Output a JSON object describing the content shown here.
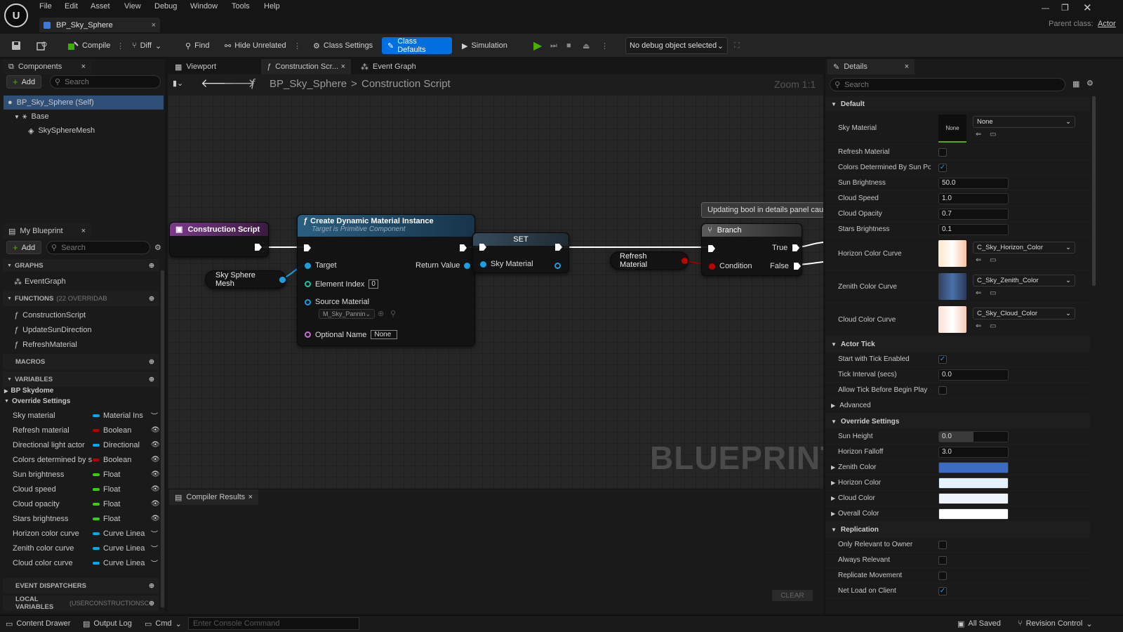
{
  "menu": [
    "File",
    "Edit",
    "Asset",
    "View",
    "Debug",
    "Window",
    "Tools",
    "Help"
  ],
  "document_tab": "BP_Sky_Sphere",
  "parent_class_label": "Parent class:",
  "parent_class_value": "Actor",
  "toolbar": {
    "compile": "Compile",
    "diff": "Diff",
    "find": "Find",
    "hide_unrelated": "Hide Unrelated",
    "class_settings": "Class Settings",
    "class_defaults": "Class Defaults",
    "simulation": "Simulation",
    "debug_object": "No debug object selected"
  },
  "components": {
    "title": "Components",
    "add": "Add",
    "search_placeholder": "Search",
    "self": "BP_Sky_Sphere (Self)",
    "base": "Base",
    "mesh": "SkySphereMesh"
  },
  "my_blueprint": {
    "title": "My Blueprint",
    "add": "Add",
    "search_placeholder": "Search",
    "graphs_label": "GRAPHS",
    "event_graph": "EventGraph",
    "functions_label": "FUNCTIONS",
    "functions_note": "(22 OVERRIDAB",
    "functions": [
      "ConstructionScript",
      "UpdateSunDirection",
      "RefreshMaterial"
    ],
    "macros_label": "MACROS",
    "variables_label": "VARIABLES",
    "categories": [
      "BP Skydome",
      "Override Settings"
    ],
    "variables": [
      {
        "name": "Sky material",
        "type": "Material Ins",
        "color": "#00a8f0"
      },
      {
        "name": "Refresh material",
        "type": "Boolean",
        "color": "#b00000"
      },
      {
        "name": "Directional light actor",
        "type": "Directional",
        "color": "#00a8f0"
      },
      {
        "name": "Colors determined by s",
        "type": "Boolean",
        "color": "#b00000"
      },
      {
        "name": "Sun brightness",
        "type": "Float",
        "color": "#38d000"
      },
      {
        "name": "Cloud speed",
        "type": "Float",
        "color": "#38d000"
      },
      {
        "name": "Cloud opacity",
        "type": "Float",
        "color": "#38d000"
      },
      {
        "name": "Stars brightness",
        "type": "Float",
        "color": "#38d000"
      },
      {
        "name": "Horizon color curve",
        "type": "Curve Linea",
        "color": "#00a8f0"
      },
      {
        "name": "Zenith color curve",
        "type": "Curve Linea",
        "color": "#00a8f0"
      },
      {
        "name": "Cloud color curve",
        "type": "Curve Linea",
        "color": "#00a8f0"
      }
    ],
    "event_dispatchers_label": "EVENT DISPATCHERS",
    "local_variables_label": "LOCAL VARIABLES",
    "local_variables_note": "(USERCONSTRUCTIONSC"
  },
  "editor_tabs": [
    "Viewport",
    "Construction Scr...",
    "Event Graph"
  ],
  "breadcrumb": {
    "blueprint": "BP_Sky_Sphere",
    "graph": "Construction Script"
  },
  "zoom": "Zoom 1:1",
  "watermark": "BLUEPRINT",
  "nodes": {
    "construction_script": "Construction Script",
    "sky_sphere_mesh": "Sky Sphere Mesh",
    "create_dmi_title": "Create Dynamic Material Instance",
    "create_dmi_subtitle": "Target is Primitive Component",
    "target": "Target",
    "return_value": "Return Value",
    "element_index": "Element Index",
    "element_index_value": "0",
    "source_material": "Source Material",
    "source_material_value": "M_Sky_Panning",
    "optional_name": "Optional Name",
    "optional_name_value": "None",
    "set": "SET",
    "sky_material": "Sky Material",
    "refresh_material": "Refresh Material",
    "comment": "Updating bool in details panel cause",
    "branch": "Branch",
    "condition": "Condition",
    "true_pin": "True",
    "false_pin": "False"
  },
  "compiler": {
    "tab": "Compiler Results",
    "clear": "CLEAR"
  },
  "details": {
    "title": "Details",
    "search_placeholder": "Search",
    "default_section": "Default",
    "sky_material_label": "Sky Material",
    "sky_material_thumb": "None",
    "sky_material_value": "None",
    "refresh_material_label": "Refresh Material",
    "colors_determined_label": "Colors Determined By Sun Pos...",
    "sun_brightness_label": "Sun Brightness",
    "sun_brightness": "50.0",
    "cloud_speed_label": "Cloud Speed",
    "cloud_speed": "1.0",
    "cloud_opacity_label": "Cloud Opacity",
    "cloud_opacity": "0.7",
    "stars_brightness_label": "Stars Brightness",
    "stars_brightness": "0.1",
    "horizon_curve_label": "Horizon Color Curve",
    "horizon_curve": "C_Sky_Horizon_Color",
    "zenith_curve_label": "Zenith Color Curve",
    "zenith_curve": "C_Sky_Zenith_Color",
    "cloud_curve_label": "Cloud Color Curve",
    "cloud_curve": "C_Sky_Cloud_Color",
    "actor_tick_section": "Actor Tick",
    "start_tick_label": "Start with Tick Enabled",
    "tick_interval_label": "Tick Interval (secs)",
    "tick_interval": "0.0",
    "allow_tick_label": "Allow Tick Before Begin Play",
    "advanced_label": "Advanced",
    "override_section": "Override Settings",
    "sun_height_label": "Sun Height",
    "sun_height": "0.0",
    "sun_height_fraction": 0.5,
    "horizon_falloff_label": "Horizon Falloff",
    "horizon_falloff": "3.0",
    "zenith_color_label": "Zenith Color",
    "zenith_color": "#3b6cc4",
    "horizon_color_label": "Horizon Color",
    "horizon_color": "#e4f1fb",
    "cloud_color_label": "Cloud Color",
    "cloud_color": "#eef4fa",
    "overall_color_label": "Overall Color",
    "overall_color": "#ffffff",
    "replication_section": "Replication",
    "only_relevant_label": "Only Relevant to Owner",
    "always_relevant_label": "Always Relevant",
    "replicate_movement_label": "Replicate Movement",
    "net_load_label": "Net Load on Client"
  },
  "status": {
    "content_drawer": "Content Drawer",
    "output_log": "Output Log",
    "cmd": "Cmd",
    "console_placeholder": "Enter Console Command",
    "saved": "All Saved",
    "revision": "Revision Control"
  }
}
